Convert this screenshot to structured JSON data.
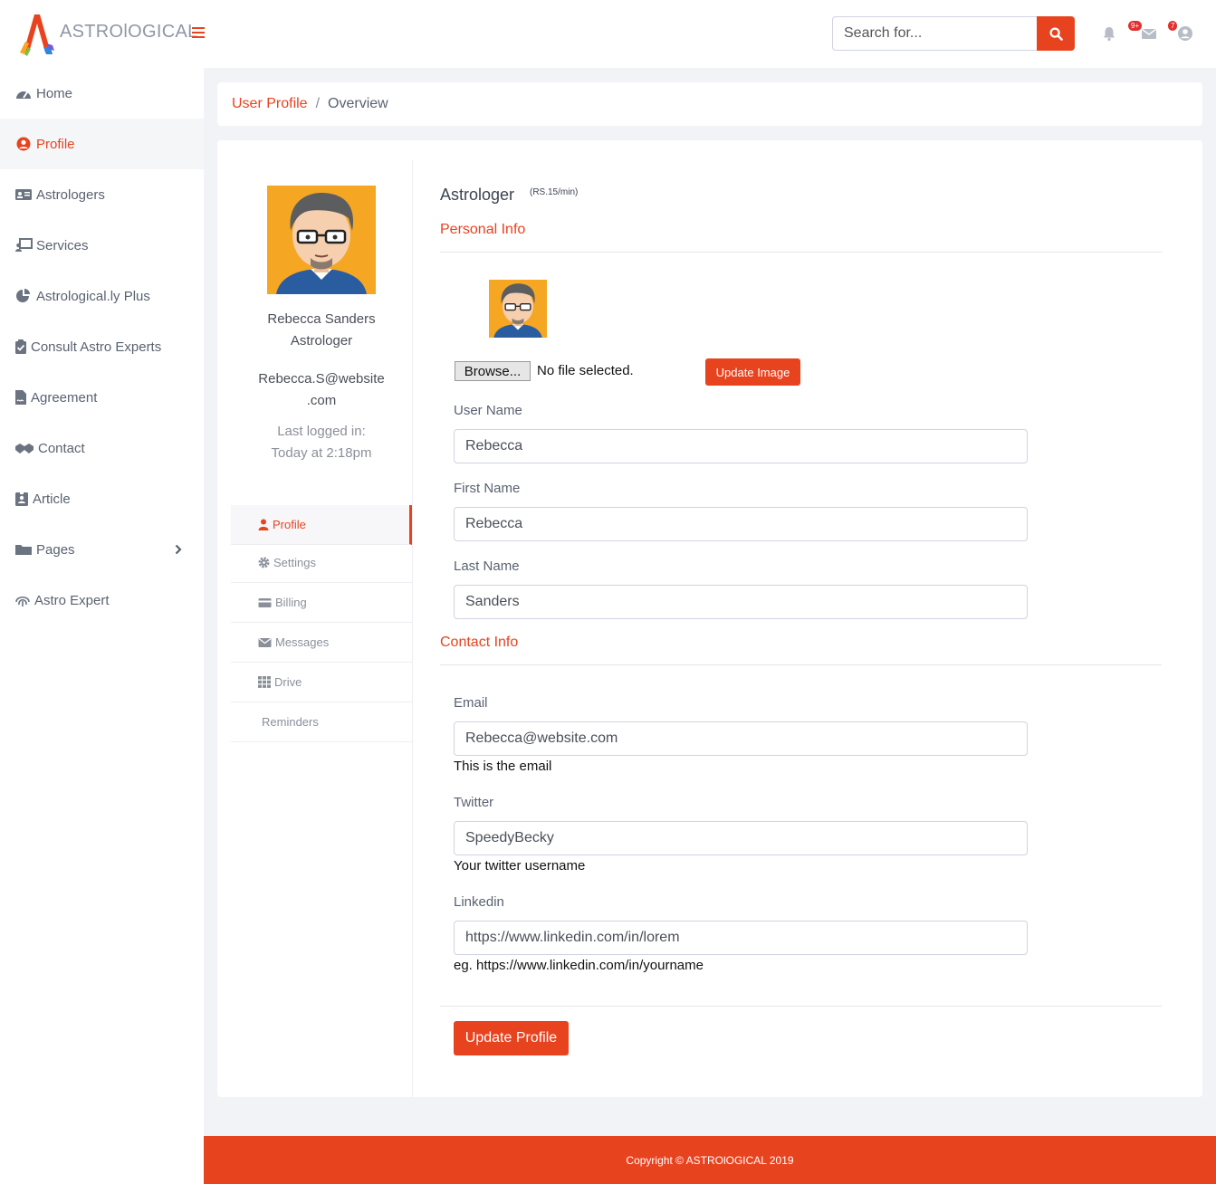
{
  "header": {
    "brand": "ASTROlOGICAL",
    "search_placeholder": "Search for...",
    "alerts_badge": "",
    "messages_badge": "9+",
    "user_badge": "7"
  },
  "sidebar": {
    "items": [
      {
        "label": "Home",
        "icon": "tachometer-icon"
      },
      {
        "label": "Profile",
        "icon": "user-circle-icon"
      },
      {
        "label": "Astrologers",
        "icon": "id-card-icon"
      },
      {
        "label": "Services",
        "icon": "chalkboard-teacher-icon"
      },
      {
        "label": "Astrological.ly Plus",
        "icon": "pie-chart-icon"
      },
      {
        "label": "Consult Astro Experts",
        "icon": "clipboard-check-icon"
      },
      {
        "label": "Agreement",
        "icon": "file-signature-icon"
      },
      {
        "label": "Contact",
        "icon": "handshake-icon"
      },
      {
        "label": "Article",
        "icon": "id-badge-icon"
      },
      {
        "label": "Pages",
        "icon": "folder-icon"
      },
      {
        "label": "Astro Expert",
        "icon": "fingerprint-icon"
      }
    ]
  },
  "breadcrumb": {
    "link": "User Profile",
    "separator": "/",
    "current": "Overview"
  },
  "profile": {
    "name": "Rebecca Sanders",
    "role": "Astrologer",
    "email_line1": "Rebecca.S@website",
    "email_line2": ".com",
    "last_logged_label": "Last logged in:",
    "last_logged_value": "Today at 2:18pm"
  },
  "submenu": [
    {
      "label": "Profile",
      "icon": "user-icon"
    },
    {
      "label": "Settings",
      "icon": "gear-icon"
    },
    {
      "label": "Billing",
      "icon": "credit-card-icon"
    },
    {
      "label": "Messages",
      "icon": "envelope-icon"
    },
    {
      "label": "Drive",
      "icon": "grid-icon"
    },
    {
      "label": "Reminders",
      "icon": ""
    }
  ],
  "form": {
    "title": "Astrologer",
    "rate": "(RS.15/min)",
    "personal_info": "Personal Info",
    "browse_label": "Browse...",
    "no_file": "No file selected.",
    "update_image": "Update Image",
    "username_label": "User Name",
    "username_value": "Rebecca",
    "firstname_label": "First Name",
    "firstname_value": "Rebecca",
    "lastname_label": "Last Name",
    "lastname_value": "Sanders",
    "contact_info": "Contact Info",
    "email_label": "Email",
    "email_value": "Rebecca@website.com",
    "email_help": "This is the email",
    "twitter_label": "Twitter",
    "twitter_value": "SpeedyBecky",
    "twitter_help": "Your twitter username",
    "linkedin_label": "Linkedin",
    "linkedin_value": "https://www.linkedin.com/in/lorem",
    "linkedin_help": "eg. https://www.linkedin.com/in/yourname",
    "update_profile": "Update Profile"
  },
  "footer": {
    "copyright": "Copyright © ASTROlOGICAL 2019"
  },
  "colors": {
    "accent": "#e8431f",
    "sidebar_text": "#5a6270"
  }
}
